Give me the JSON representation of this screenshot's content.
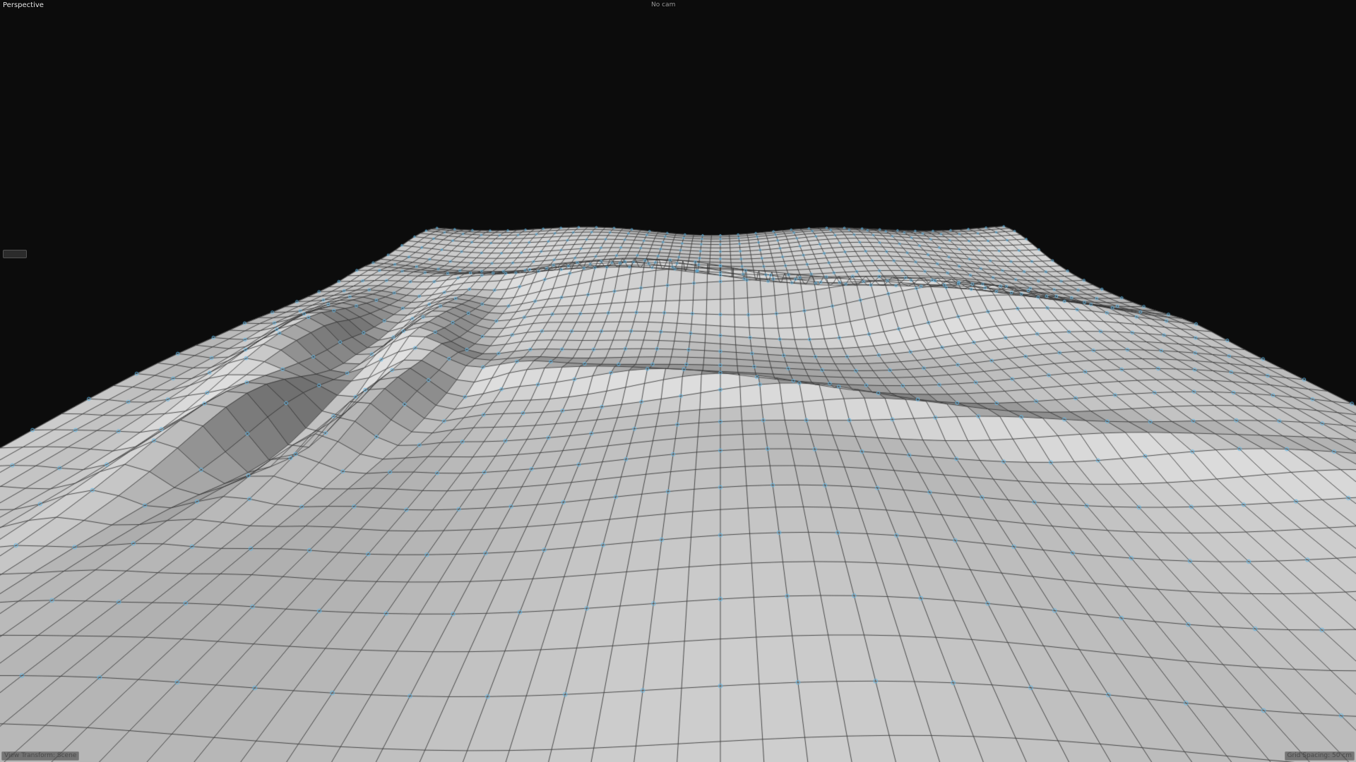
{
  "viewport": {
    "view_label": "Perspective",
    "camera_label": "No cam",
    "side_tab_label": "",
    "view_transform": "View Transform: Scene",
    "grid_spacing": "Grid Spacing: 50 cm"
  },
  "colors": {
    "background": "#0c0c0c",
    "surface_light": "#d6d6d6",
    "surface_dark": "#6f6f6f",
    "wireframe": "#2f2f2f",
    "control_point": "#5fb8e8"
  },
  "surface": {
    "object": "cloth-mesh",
    "display_mode": "wireframe-on-shaded",
    "control_points_visible": true
  }
}
